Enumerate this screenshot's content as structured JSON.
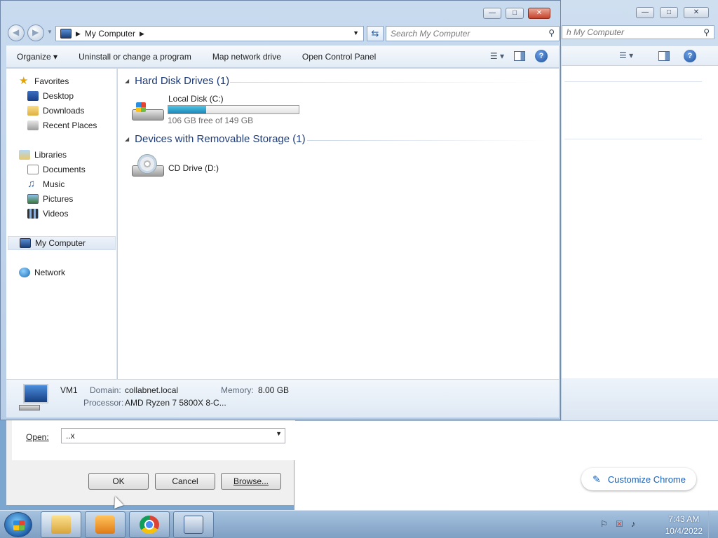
{
  "explorer": {
    "address": {
      "location": "My Computer"
    },
    "search": {
      "placeholder": "Search My Computer"
    },
    "toolbar": {
      "organize": "Organize",
      "uninstall": "Uninstall or change a program",
      "map_drive": "Map network drive",
      "control_panel": "Open Control Panel"
    },
    "nav": {
      "favorites": "Favorites",
      "desktop": "Desktop",
      "downloads": "Downloads",
      "recent_places": "Recent Places",
      "libraries": "Libraries",
      "documents": "Documents",
      "music": "Music",
      "pictures": "Pictures",
      "videos": "Videos",
      "my_computer": "My Computer",
      "network": "Network"
    },
    "groups": {
      "hdd": {
        "header": "Hard Disk Drives (1)"
      },
      "removable": {
        "header": "Devices with Removable Storage (1)"
      }
    },
    "drives": {
      "c": {
        "name": "Local Disk (C:)",
        "free_text": "106 GB free of 149 GB",
        "used_fraction": 0.29
      },
      "d": {
        "name": "CD Drive (D:)"
      }
    },
    "details": {
      "name": "VM1",
      "domain_label": "Domain:",
      "domain": "collabnet.local",
      "memory_label": "Memory:",
      "memory": "8.00 GB",
      "processor_label": "Processor:",
      "processor": "AMD Ryzen 7 5800X 8-C..."
    }
  },
  "bg_window": {
    "search_placeholder": "h My Computer"
  },
  "run_dialog": {
    "open_label": "Open:",
    "open_value": "..x",
    "ok": "OK",
    "cancel": "Cancel",
    "browse": "Browse..."
  },
  "chrome": {
    "customize": "Customize Chrome"
  },
  "taskbar": {
    "time": "7:43 AM",
    "date": "10/4/2022"
  }
}
